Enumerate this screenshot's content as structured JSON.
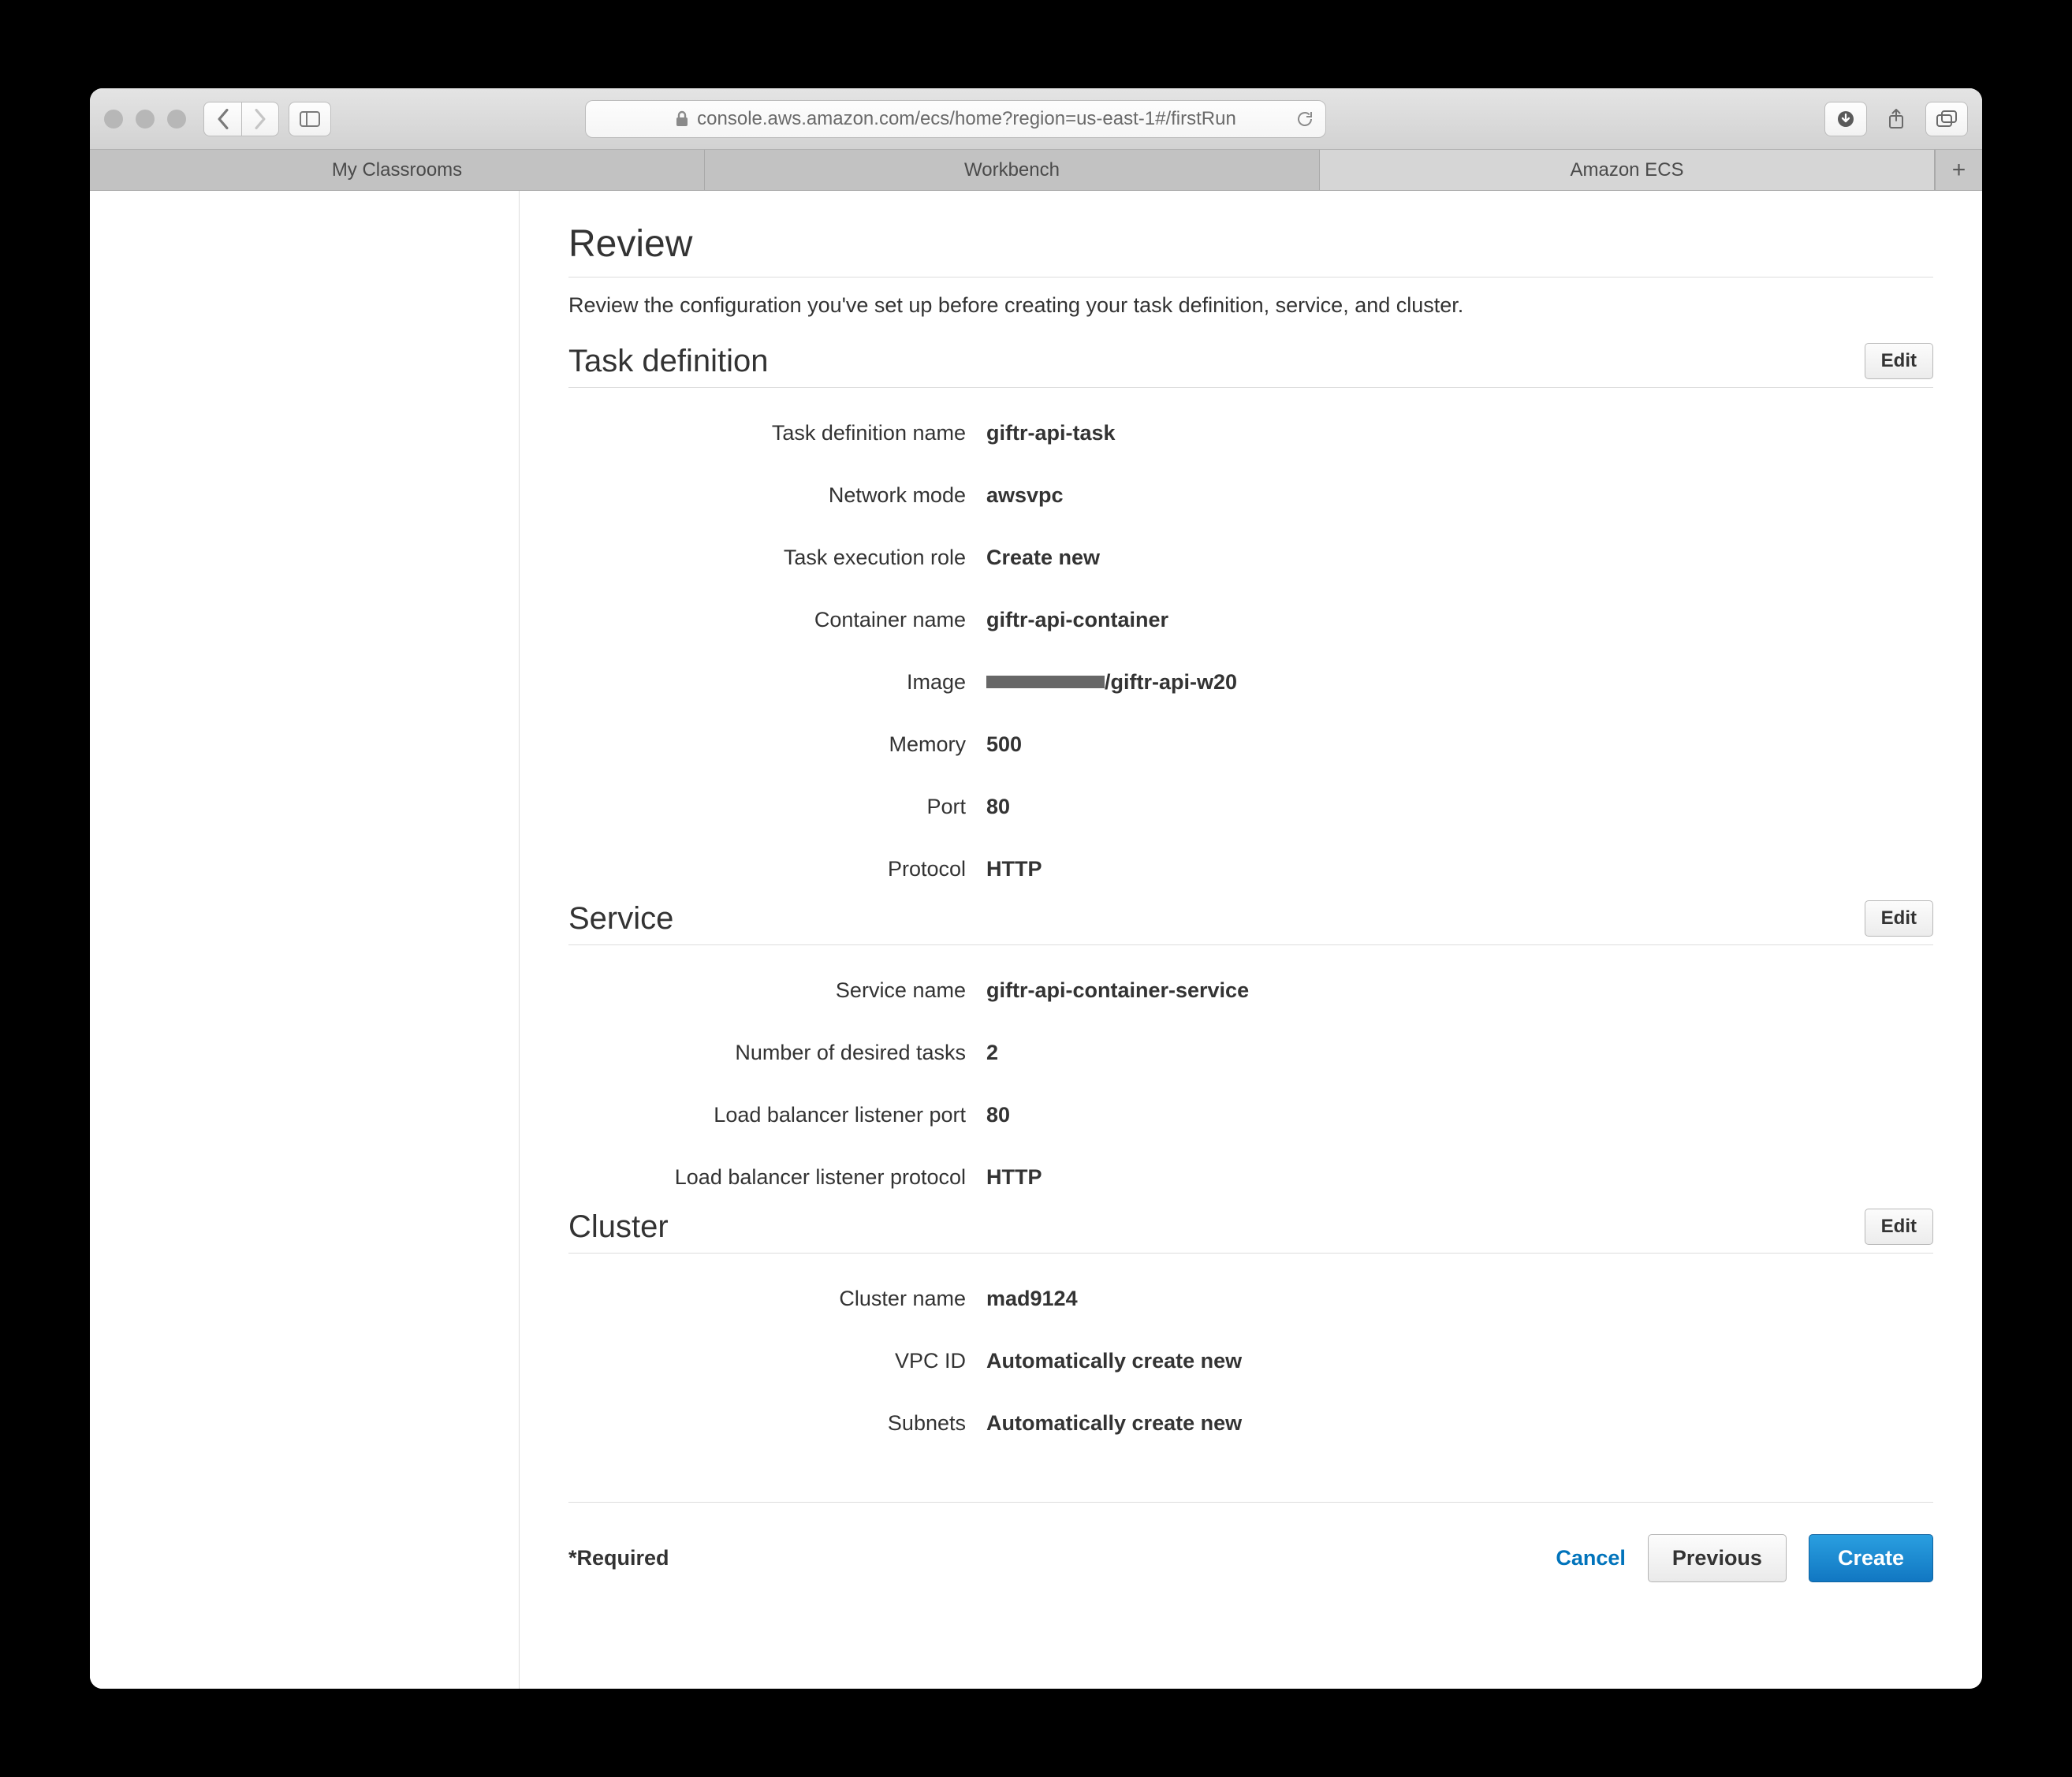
{
  "browser": {
    "url": "console.aws.amazon.com/ecs/home?region=us-east-1#/firstRun",
    "tabs": [
      "My Classrooms",
      "Workbench",
      "Amazon ECS"
    ],
    "activeTab": 2
  },
  "page": {
    "title": "Review",
    "description": "Review the configuration you've set up before creating your task definition, service, and cluster."
  },
  "sections": {
    "taskDefinition": {
      "title": "Task definition",
      "edit": "Edit",
      "rows": {
        "taskDefinitionName": {
          "label": "Task definition name",
          "value": "giftr-api-task"
        },
        "networkMode": {
          "label": "Network mode",
          "value": "awsvpc"
        },
        "taskExecRole": {
          "label": "Task execution role",
          "value": "Create new"
        },
        "containerName": {
          "label": "Container name",
          "value": "giftr-api-container"
        },
        "image": {
          "label": "Image",
          "suffix": "/giftr-api-w20"
        },
        "memory": {
          "label": "Memory",
          "value": "500"
        },
        "port": {
          "label": "Port",
          "value": "80"
        },
        "protocol": {
          "label": "Protocol",
          "value": "HTTP"
        }
      }
    },
    "service": {
      "title": "Service",
      "edit": "Edit",
      "rows": {
        "serviceName": {
          "label": "Service name",
          "value": "giftr-api-container-service"
        },
        "desiredTasks": {
          "label": "Number of desired tasks",
          "value": "2"
        },
        "lbPort": {
          "label": "Load balancer listener port",
          "value": "80"
        },
        "lbProtocol": {
          "label": "Load balancer listener protocol",
          "value": "HTTP"
        }
      }
    },
    "cluster": {
      "title": "Cluster",
      "edit": "Edit",
      "rows": {
        "clusterName": {
          "label": "Cluster name",
          "value": "mad9124"
        },
        "vpcId": {
          "label": "VPC ID",
          "value": "Automatically create new"
        },
        "subnets": {
          "label": "Subnets",
          "value": "Automatically create new"
        }
      }
    }
  },
  "footer": {
    "required": "*Required",
    "cancel": "Cancel",
    "previous": "Previous",
    "create": "Create"
  }
}
